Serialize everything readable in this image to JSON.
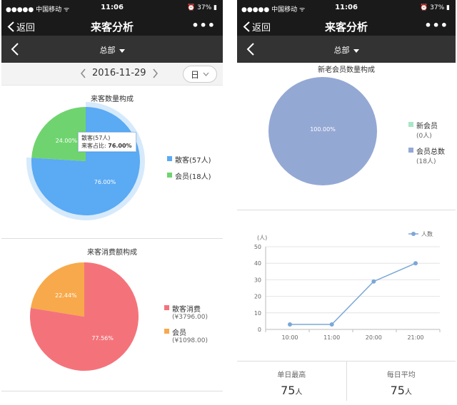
{
  "left": {
    "status": {
      "carrier": "●●●●● 中国移动 ᯤ",
      "time": "11:06",
      "right": "⏰ 37% ▮"
    },
    "nav": {
      "back": "返回",
      "title": "来客分析",
      "more": "•••"
    },
    "dept": "总部",
    "date": "2016-11-29",
    "period": "日",
    "pie1": {
      "title": "来客数量构成",
      "slices": [
        {
          "name": "散客",
          "value": 76.0,
          "label": "76.00%",
          "legend": "散客(57人)",
          "color": "#5aaaf4"
        },
        {
          "name": "会员",
          "value": 24.0,
          "label": "24.00%",
          "legend": "会员(18人)",
          "color": "#6fd46f"
        }
      ],
      "tooltip": {
        "line1": "散客(57人)",
        "line2_prefix": "来客占比: ",
        "line2_value": "76.00%"
      }
    },
    "pie2": {
      "title": "来客消费额构成",
      "slices": [
        {
          "name": "散客消费",
          "value": 77.56,
          "label": "77.56%",
          "legend": "散客消费",
          "amount": "(¥3796.00)",
          "color": "#f4737a"
        },
        {
          "name": "会员",
          "value": 22.44,
          "label": "22.44%",
          "legend": "会员",
          "amount": "(¥1098.00)",
          "color": "#f8a94b"
        }
      ]
    }
  },
  "right": {
    "status": {
      "carrier": "●●●●● 中国移动 ᯤ",
      "time": "11:06",
      "right": "⏰ 37% ▮"
    },
    "nav": {
      "back": "返回",
      "title": "来客分析",
      "more": "•••"
    },
    "dept": "总部",
    "pie3": {
      "title": "新老会员数量构成",
      "slices": [
        {
          "name": "会员总数",
          "value": 100.0,
          "label": "100.00%",
          "color": "#94a8d4"
        }
      ],
      "legend": [
        {
          "name": "新会员",
          "sub": "(0人)",
          "color": "#a8e6c8"
        },
        {
          "name": "会员总数",
          "sub": "(18人)",
          "color": "#94a8d4"
        }
      ]
    },
    "stats": {
      "max_label": "单日最高",
      "max_value": "75",
      "max_unit": "人",
      "avg_label": "每日平均",
      "avg_value": "75",
      "avg_unit": "人"
    }
  },
  "chart_data": {
    "type": "line",
    "ylabel": "(人)",
    "series": [
      {
        "name": "人数",
        "values": [
          3,
          3,
          29,
          40
        ]
      }
    ],
    "categories": [
      "10:00",
      "11:00",
      "20:00",
      "21:00"
    ],
    "ylim": [
      0,
      50
    ],
    "yticks": [
      0,
      10,
      20,
      30,
      40,
      50
    ],
    "grid": true,
    "legend": "top-right",
    "color": "#7aa7d8"
  }
}
